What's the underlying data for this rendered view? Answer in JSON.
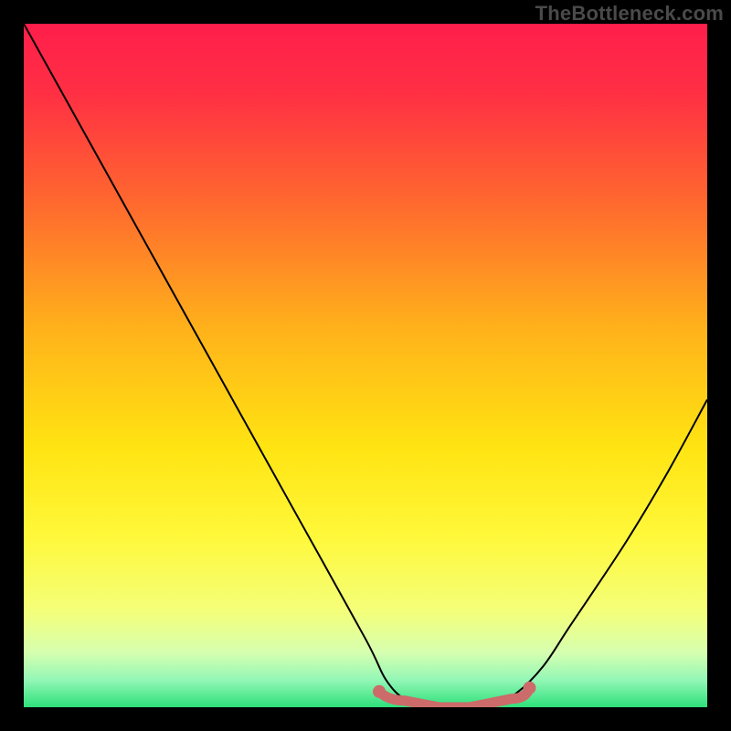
{
  "watermark": "TheBottleneck.com",
  "chart_data": {
    "type": "line",
    "title": "",
    "xlabel": "",
    "ylabel": "",
    "xlim": [
      0,
      100
    ],
    "ylim": [
      0,
      100
    ],
    "series": [
      {
        "name": "bottleneck-curve",
        "x": [
          0,
          10,
          20,
          30,
          40,
          50,
          53,
          56,
          60,
          64,
          68,
          72,
          76,
          80,
          88,
          94,
          100
        ],
        "y": [
          100,
          82,
          64,
          46,
          28,
          10,
          4,
          1,
          0,
          0,
          0,
          2,
          6,
          12,
          24,
          34,
          45
        ],
        "color": "#000000"
      }
    ],
    "annotations": [
      {
        "name": "optimal-range-marker",
        "x_start": 52,
        "x_end": 74,
        "y": 1.5,
        "color": "#cd6a6a"
      }
    ],
    "background_gradient": {
      "stops": [
        {
          "offset": 0.0,
          "color": "#ff1e4b"
        },
        {
          "offset": 0.1,
          "color": "#ff2f44"
        },
        {
          "offset": 0.25,
          "color": "#ff6430"
        },
        {
          "offset": 0.45,
          "color": "#ffb31a"
        },
        {
          "offset": 0.62,
          "color": "#ffe412"
        },
        {
          "offset": 0.75,
          "color": "#fff83a"
        },
        {
          "offset": 0.86,
          "color": "#f4ff7a"
        },
        {
          "offset": 0.92,
          "color": "#d6ffb0"
        },
        {
          "offset": 0.96,
          "color": "#93f7b6"
        },
        {
          "offset": 1.0,
          "color": "#2de07a"
        }
      ]
    }
  }
}
